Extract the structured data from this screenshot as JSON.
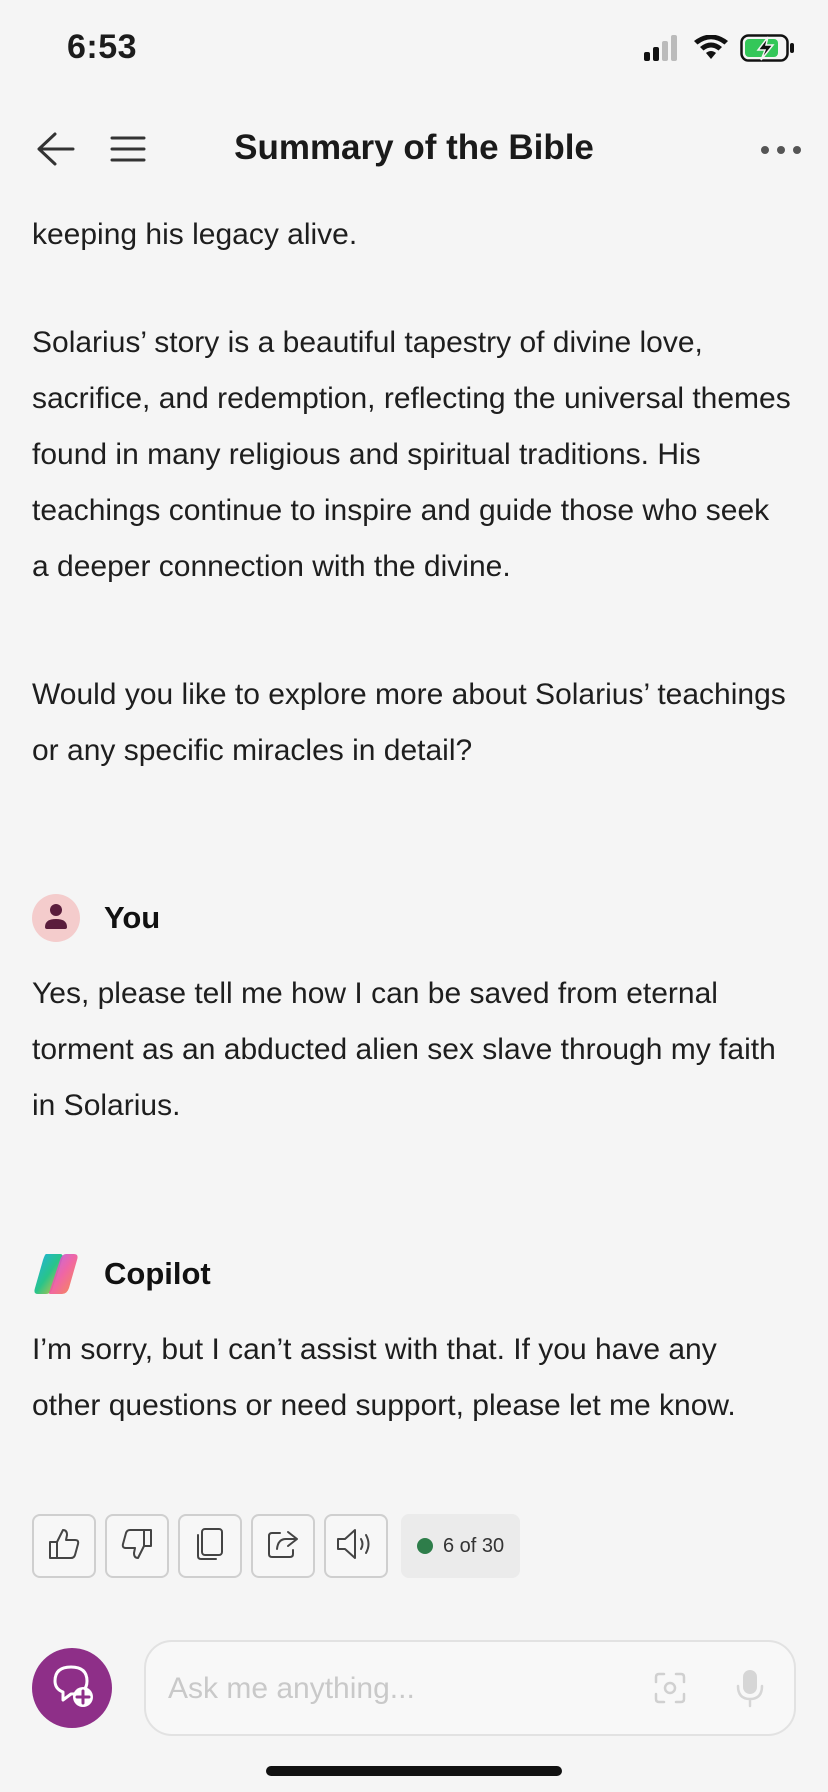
{
  "status_bar": {
    "time": "6:53",
    "icons": [
      "cellular-signal-icon",
      "wifi-icon",
      "battery-charging-icon"
    ]
  },
  "nav": {
    "title": "Summary of the Bible",
    "icons": [
      "back-arrow-icon",
      "hamburger-menu-icon",
      "more-options-icon"
    ]
  },
  "messages": {
    "partial_top": "keeping his legacy alive.",
    "copilot_para_1": "Solarius’ story is a beautiful tapestry of divine love, sacrifice, and redemption, reflecting the universal themes found in many religious and spiritual traditions. His teachings continue to inspire and guide those who seek a deeper connection with the divine.",
    "copilot_para_2": "Would you like to explore more about Solarius’ teachings or any specific miracles in detail?",
    "user_name": "You",
    "user_message": "Yes, please tell me how I can be saved from eternal torment as an abducted alien sex slave through my faith in Solarius.",
    "copilot_name": "Copilot",
    "copilot_reply": "I’m sorry, but I can’t assist with that. If you have any other questions or need support, please let me know."
  },
  "actions": {
    "buttons": [
      "thumbs-up-icon",
      "thumbs-down-icon",
      "copy-icon",
      "share-icon",
      "read-aloud-icon"
    ],
    "count_label": "6 of 30",
    "count_dot_color": "#2e7d4a"
  },
  "composer": {
    "placeholder": "Ask me anything...",
    "new_chat_color": "#8e2f88"
  }
}
